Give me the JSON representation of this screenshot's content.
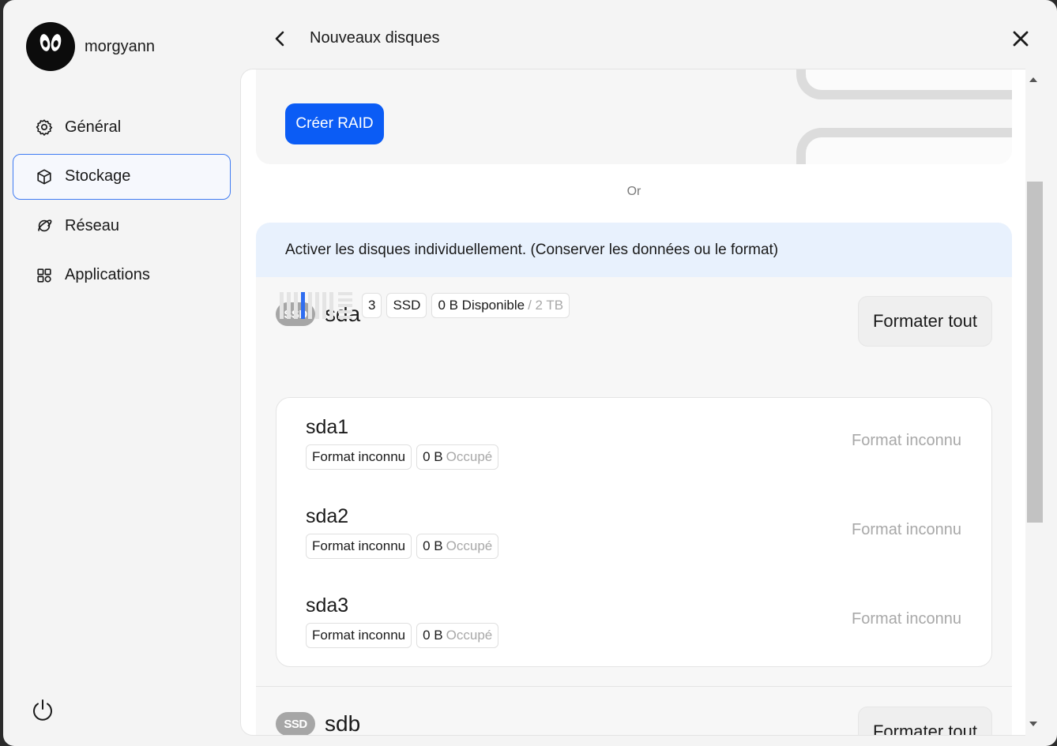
{
  "user": {
    "name": "morgyann"
  },
  "nav": [
    {
      "label": "Général",
      "icon": "gear-icon",
      "active": false
    },
    {
      "label": "Stockage",
      "icon": "box-icon",
      "active": true
    },
    {
      "label": "Réseau",
      "icon": "planet-icon",
      "active": false
    },
    {
      "label": "Applications",
      "icon": "grid-icon",
      "active": false
    }
  ],
  "header": {
    "title": "Nouveaux disques"
  },
  "raid": {
    "button_label": "Créer RAID"
  },
  "or_label": "Or",
  "individual": {
    "heading": "Activer les disques individuellement. (Conserver les données ou le format)"
  },
  "disks": [
    {
      "badge": "SSD",
      "name": "sda",
      "format_all_label": "Formater tout",
      "slot_count": "3",
      "type": "SSD",
      "available": "0 B Disponible",
      "total": "/ 2 TB",
      "partitions": [
        {
          "name": "sda1",
          "format": "Format inconnu",
          "size": "0 B",
          "occupied": "Occupé",
          "status": "Format inconnu"
        },
        {
          "name": "sda2",
          "format": "Format inconnu",
          "size": "0 B",
          "occupied": "Occupé",
          "status": "Format inconnu"
        },
        {
          "name": "sda3",
          "format": "Format inconnu",
          "size": "0 B",
          "occupied": "Occupé",
          "status": "Format inconnu"
        }
      ]
    },
    {
      "badge": "SSD",
      "name": "sdb",
      "format_all_label": "Formater tout"
    }
  ],
  "colors": {
    "accent": "#0b5cf5",
    "active_border": "#3f7bf3",
    "section_head_bg": "#e8f1fd",
    "badge_bg": "#a6a6a6"
  }
}
